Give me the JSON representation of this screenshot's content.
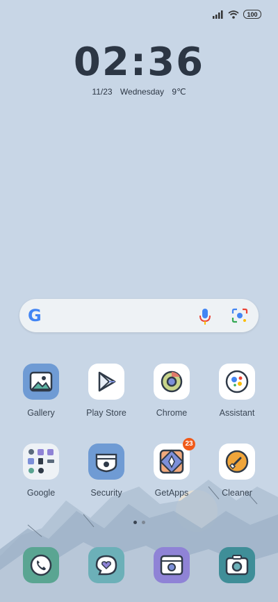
{
  "status_bar": {
    "battery": "100",
    "signal_icon": "signal-icon",
    "wifi_icon": "wifi-icon"
  },
  "lockclock": {
    "time": "02:36",
    "date": "11/23",
    "weekday": "Wednesday",
    "temperature": "9℃"
  },
  "search_bar": {
    "logo": "G",
    "mic_icon": "mic-icon",
    "lens_icon": "lens-icon"
  },
  "apps_row1": [
    {
      "label": "Gallery",
      "icon": "gallery-icon",
      "color": "#6f9bd4"
    },
    {
      "label": "Play Store",
      "icon": "play-store-icon",
      "color": "#ffffff"
    },
    {
      "label": "Chrome",
      "icon": "chrome-icon",
      "color": "#ffffff"
    },
    {
      "label": "Assistant",
      "icon": "assistant-icon",
      "color": "#ffffff"
    }
  ],
  "apps_row2": [
    {
      "label": "Google",
      "icon": "google-folder-icon",
      "color": "#eef2f6"
    },
    {
      "label": "Security",
      "icon": "security-icon",
      "color": "#6f9bd4"
    },
    {
      "label": "GetApps",
      "icon": "getapps-icon",
      "color": "#ffffff",
      "badge": "23"
    },
    {
      "label": "Cleaner",
      "icon": "cleaner-icon",
      "color": "#ffffff"
    }
  ],
  "dock": [
    {
      "icon": "phone-icon",
      "color": "#5aa592"
    },
    {
      "icon": "messages-icon",
      "color": "#6cb0b8"
    },
    {
      "icon": "browser-icon",
      "color": "#8f83d6"
    },
    {
      "icon": "camera-icon",
      "color": "#3f8e98"
    }
  ],
  "pager": {
    "pages": 2,
    "current": 1
  }
}
